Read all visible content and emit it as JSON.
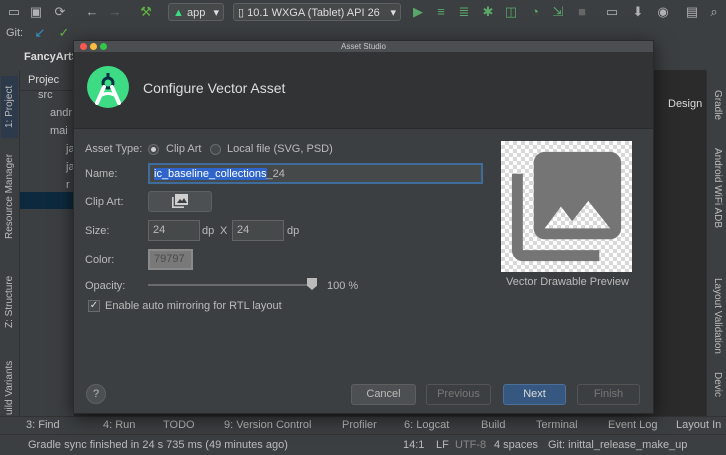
{
  "toolbar": {
    "run_config": "app",
    "device": "10.1  WXGA (Tablet) API 26",
    "git_label": "Git:"
  },
  "navbar": {
    "project_tab": "FancyArtS",
    "editor_tab_partial": "up",
    "design_tab": "Design"
  },
  "project_panel": {
    "header": "Projec",
    "tree": [
      "src",
      "andr",
      "mai",
      "ja",
      "ja",
      "r"
    ]
  },
  "left_stripe": [
    "1: Project",
    "Resource Manager",
    "Z: Structure",
    "uild Variants"
  ],
  "right_stripe": [
    "Gradle",
    "Android WiFi ADB",
    "Layout Validation",
    "Devic"
  ],
  "dialog": {
    "window_title": "Asset Studio",
    "header_title": "Configure Vector Asset",
    "asset_type_label": "Asset Type:",
    "asset_type_options": [
      "Clip Art",
      "Local file (SVG, PSD)"
    ],
    "asset_type_selected": "Clip Art",
    "name_label": "Name:",
    "name_selected": "ic_baseline_collections",
    "name_rest": "_24",
    "clip_art_label": "Clip Art:",
    "size_label": "Size:",
    "width": "24",
    "height": "24",
    "unit": "dp",
    "x_sep": "X",
    "color_label": "Color:",
    "color_value": "79797",
    "opacity_label": "Opacity:",
    "opacity_percent": 100,
    "opacity_text": "100 %",
    "mirror_label": "Enable auto mirroring for RTL layout",
    "mirror_checked": true,
    "preview_caption": "Vector Drawable Preview",
    "help": "?",
    "buttons": {
      "cancel": "Cancel",
      "previous": "Previous",
      "next": "Next",
      "finish": "Finish"
    }
  },
  "bottom_tools": [
    "3: Find",
    "4: Run",
    "TODO",
    "9: Version Control",
    "Profiler",
    "6: Logcat",
    "Build",
    "Terminal",
    "Event Log",
    "Layout In"
  ],
  "status": {
    "message": "Gradle sync finished in 24 s 735 ms (49 minutes ago)",
    "position": "14:1",
    "line_sep": "LF",
    "encoding": "UTF-8",
    "indent": "4 spaces",
    "branch": "Git: inittal_release_make_up"
  },
  "colors": {
    "accent": "#365880",
    "selection": "#2f65ca",
    "android_green": "#3ddc84"
  }
}
